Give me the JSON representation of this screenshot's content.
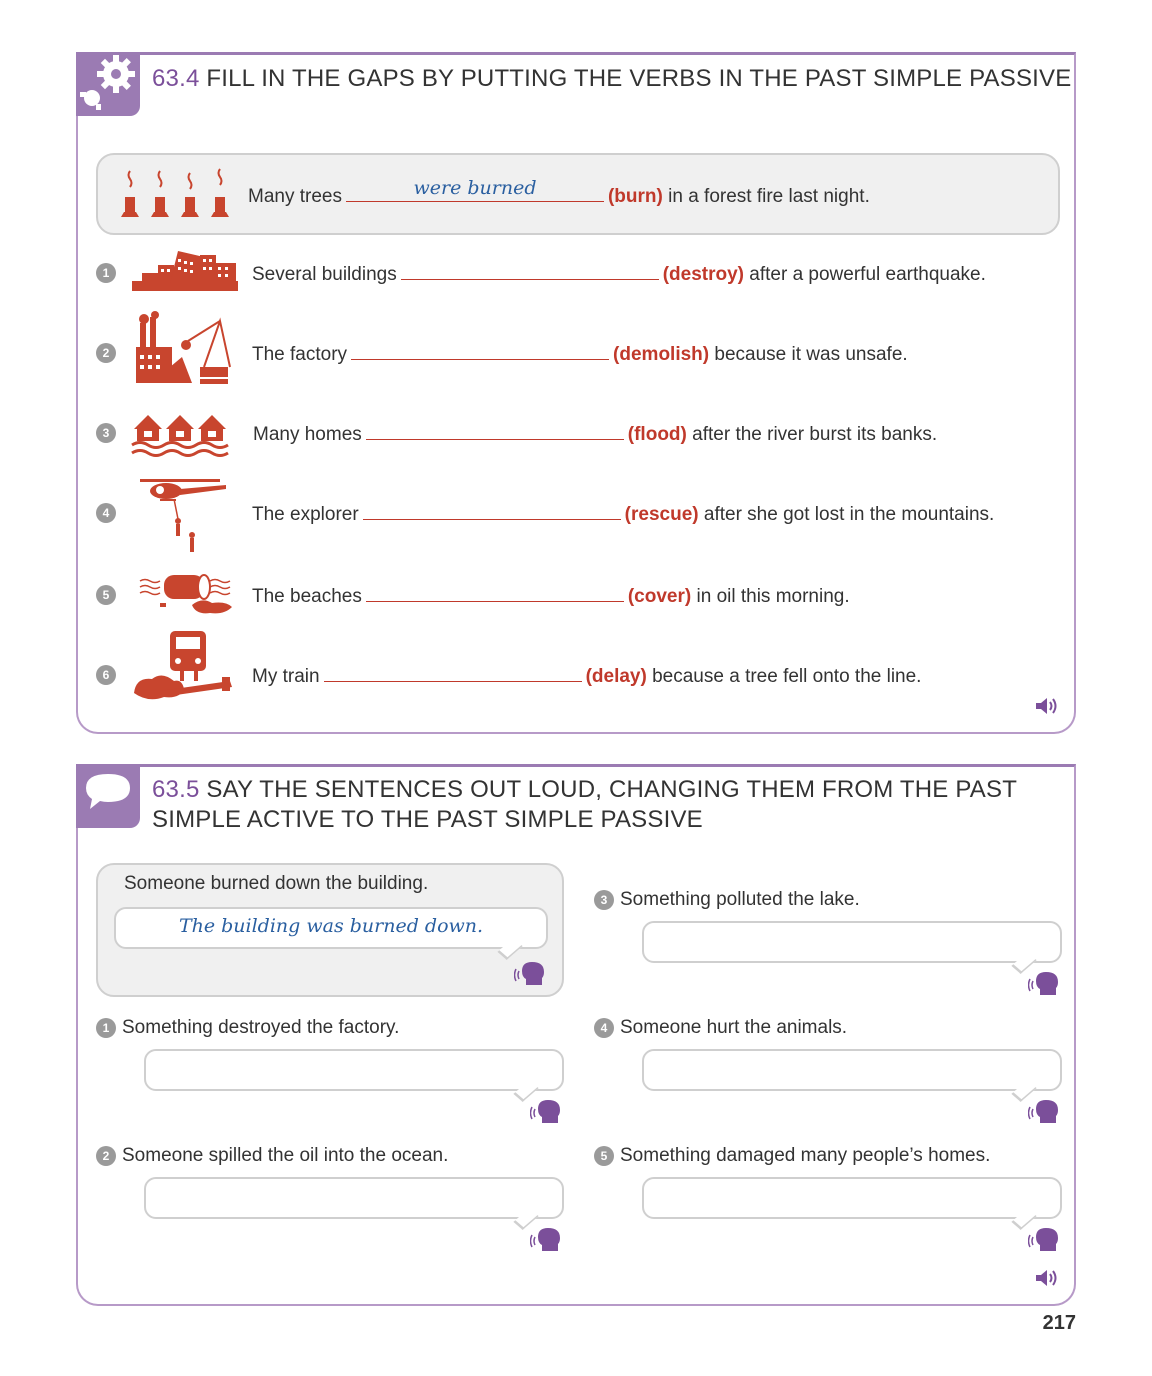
{
  "ex1": {
    "number": "63.4",
    "title": "FILL IN THE GAPS BY PUTTING THE VERBS IN THE PAST SIMPLE PASSIVE",
    "example": {
      "before": "Many trees",
      "answer": "were burned",
      "verb": "(burn)",
      "after": "in a forest fire last night."
    },
    "items": [
      {
        "num": "1",
        "before": "Several buildings",
        "verb": "(destroy)",
        "after": "after a powerful earthquake."
      },
      {
        "num": "2",
        "before": "The factory",
        "verb": "(demolish)",
        "after": "because it was unsafe."
      },
      {
        "num": "3",
        "before": "Many homes",
        "verb": "(flood)",
        "after": "after the river burst its banks."
      },
      {
        "num": "4",
        "before": "The explorer",
        "verb": "(rescue)",
        "after": "after she got lost in the mountains."
      },
      {
        "num": "5",
        "before": "The beaches",
        "verb": "(cover)",
        "after": "in oil this morning."
      },
      {
        "num": "6",
        "before": "My train",
        "verb": "(delay)",
        "after": "because a tree fell onto the line."
      }
    ]
  },
  "ex2": {
    "number": "63.5",
    "title_line1": "SAY THE SENTENCES OUT LOUD, CHANGING THEM FROM THE PAST",
    "title_line2": "SIMPLE ACTIVE TO THE PAST SIMPLE PASSIVE",
    "example": {
      "prompt": "Someone burned down the building.",
      "answer": "The building was burned down."
    },
    "items": [
      {
        "num": "1",
        "prompt": "Something destroyed the factory."
      },
      {
        "num": "2",
        "prompt": "Someone spilled the oil into the ocean."
      },
      {
        "num": "3",
        "prompt": "Something polluted the lake."
      },
      {
        "num": "4",
        "prompt": "Someone hurt the animals."
      },
      {
        "num": "5",
        "prompt": "Something damaged many people’s homes."
      }
    ]
  },
  "page_number": "217",
  "colors": {
    "accent": "#9b7bb3",
    "verb": "#c0392b",
    "answer": "#2a5fa0",
    "icon_red": "#c8452e"
  }
}
